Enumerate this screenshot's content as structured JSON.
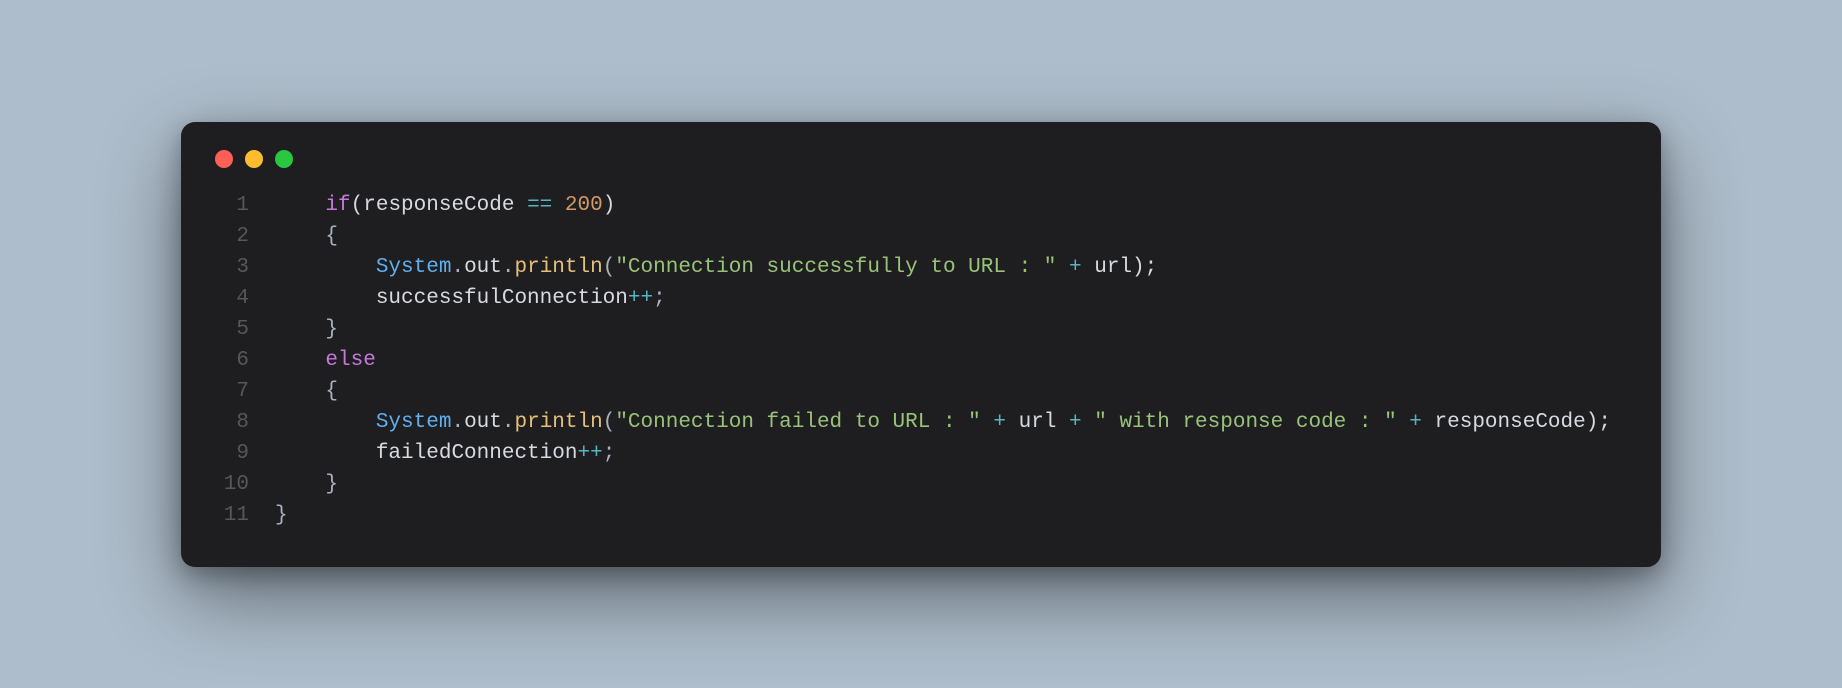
{
  "window": {
    "traffic_lights": {
      "close_color": "#ff5f57",
      "minimize_color": "#febc2e",
      "zoom_color": "#28c840"
    }
  },
  "code": {
    "line_count": 11,
    "indent": "    ",
    "lines": [
      {
        "n": 1,
        "indent": 1,
        "tokens": [
          {
            "t": "if",
            "c": "keyword"
          },
          {
            "t": "(responseCode ",
            "c": "ident"
          },
          {
            "t": "==",
            "c": "op"
          },
          {
            "t": " ",
            "c": "ident"
          },
          {
            "t": "200",
            "c": "number"
          },
          {
            "t": ")",
            "c": "ident"
          }
        ]
      },
      {
        "n": 2,
        "indent": 1,
        "tokens": [
          {
            "t": "{",
            "c": "punct"
          }
        ]
      },
      {
        "n": 3,
        "indent": 2,
        "tokens": [
          {
            "t": "System",
            "c": "class"
          },
          {
            "t": ".",
            "c": "punct"
          },
          {
            "t": "out",
            "c": "ident"
          },
          {
            "t": ".",
            "c": "punct"
          },
          {
            "t": "println",
            "c": "method"
          },
          {
            "t": "(",
            "c": "punct"
          },
          {
            "t": "\"Connection successfully to URL : \"",
            "c": "string"
          },
          {
            "t": " ",
            "c": "ident"
          },
          {
            "t": "+",
            "c": "op"
          },
          {
            "t": " url);",
            "c": "ident"
          }
        ]
      },
      {
        "n": 4,
        "indent": 2,
        "tokens": [
          {
            "t": "successfulConnection",
            "c": "ident"
          },
          {
            "t": "++",
            "c": "op"
          },
          {
            "t": ";",
            "c": "punct"
          }
        ]
      },
      {
        "n": 5,
        "indent": 1,
        "tokens": [
          {
            "t": "}",
            "c": "punct"
          }
        ]
      },
      {
        "n": 6,
        "indent": 1,
        "tokens": [
          {
            "t": "else",
            "c": "keyword"
          }
        ]
      },
      {
        "n": 7,
        "indent": 1,
        "tokens": [
          {
            "t": "{",
            "c": "punct"
          }
        ]
      },
      {
        "n": 8,
        "indent": 2,
        "tokens": [
          {
            "t": "System",
            "c": "class"
          },
          {
            "t": ".",
            "c": "punct"
          },
          {
            "t": "out",
            "c": "ident"
          },
          {
            "t": ".",
            "c": "punct"
          },
          {
            "t": "println",
            "c": "method"
          },
          {
            "t": "(",
            "c": "punct"
          },
          {
            "t": "\"Connection failed to URL : \"",
            "c": "string"
          },
          {
            "t": " ",
            "c": "ident"
          },
          {
            "t": "+",
            "c": "op"
          },
          {
            "t": " url ",
            "c": "ident"
          },
          {
            "t": "+",
            "c": "op"
          },
          {
            "t": " ",
            "c": "ident"
          },
          {
            "t": "\" with response code : \"",
            "c": "string"
          },
          {
            "t": " ",
            "c": "ident"
          },
          {
            "t": "+",
            "c": "op"
          },
          {
            "t": " responseCode);",
            "c": "ident"
          }
        ]
      },
      {
        "n": 9,
        "indent": 2,
        "tokens": [
          {
            "t": "failedConnection",
            "c": "ident"
          },
          {
            "t": "++",
            "c": "op"
          },
          {
            "t": ";",
            "c": "punct"
          }
        ]
      },
      {
        "n": 10,
        "indent": 1,
        "tokens": [
          {
            "t": "}",
            "c": "punct"
          }
        ]
      },
      {
        "n": 11,
        "indent": 0,
        "tokens": [
          {
            "t": "}",
            "c": "punct"
          }
        ]
      }
    ]
  }
}
